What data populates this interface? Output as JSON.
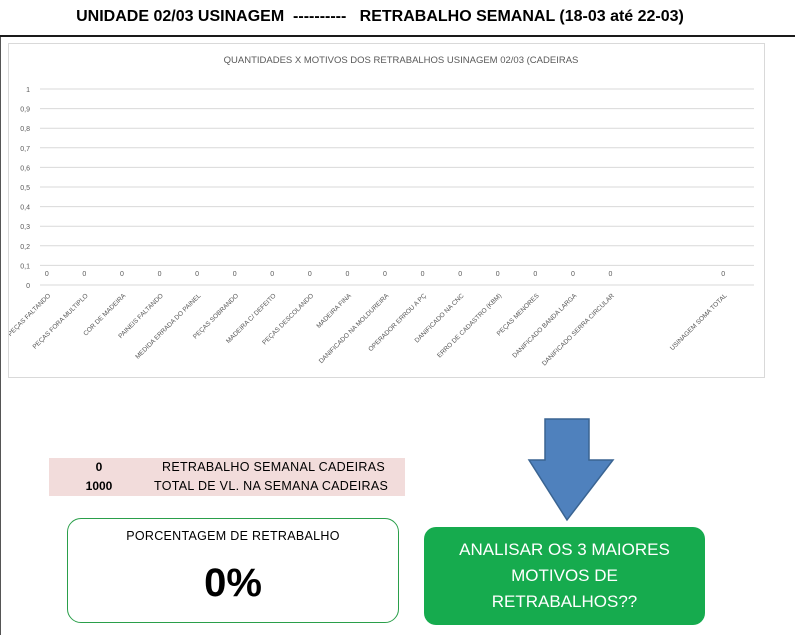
{
  "header": {
    "title": "UNIDADE 02/03 USINAGEM  ----------   RETRABALHO SEMANAL (18-03 até 22-03)"
  },
  "chart_data": {
    "type": "bar",
    "title": "QUANTIDADES X MOTIVOS DOS RETRABALHOS USINAGEM 02/03 (CADEIRAS",
    "xlabel": "",
    "ylabel": "",
    "ylim": [
      0,
      1
    ],
    "yticks": [
      "1",
      "0,9",
      "0,8",
      "0,7",
      "0,6",
      "0,5",
      "0,4",
      "0,3",
      "0,2",
      "0,1",
      "0"
    ],
    "grid": true,
    "categories": [
      "PEÇAS FALTANDO",
      "PEÇAS FORA MULTIPLO",
      "COR DE MADEIRA",
      "PAINEIS FALTANDO",
      "MEDIDA ERRADA DO PAINEL",
      "PEÇAS SOBRANDO",
      "MADEIRA C/ DEFEITO",
      "PEÇAS DESCOLANDO",
      "MADEIRA FINA",
      "DANIFICADO NA MOLDUREIRA",
      "OPERADOR ERROU A PÇ",
      "DANIFICADO NA CNC",
      "ERRO DE CADASTRO (KBM)",
      "PEÇAS MENORES",
      "DANIFICADO BANDA LARGA",
      "DANIFICADO SERRA CIRCULAR",
      "",
      "",
      "USINAGEM SOMA TOTAL"
    ],
    "values": [
      0,
      0,
      0,
      0,
      0,
      0,
      0,
      0,
      0,
      0,
      0,
      0,
      0,
      0,
      0,
      0,
      null,
      null,
      0
    ],
    "data_labels": [
      "0",
      "0",
      "0",
      "0",
      "0",
      "0",
      "0",
      "0",
      "0",
      "0",
      "0",
      "0",
      "0",
      "0",
      "0",
      "0",
      "",
      "",
      "0"
    ],
    "colors": {
      "grid": "#d9d9d9",
      "text": "#595959"
    }
  },
  "stats": {
    "rework_value": "0",
    "rework_label": "RETRABALHO SEMANAL CADEIRAS",
    "total_value": "1000",
    "total_label": "TOTAL DE VL. NA SEMANA CADEIRAS"
  },
  "percentage": {
    "label": "PORCENTAGEM DE RETRABALHO",
    "value": "0%"
  },
  "cta": {
    "text": "ANALISAR OS 3 MAIORES MOTIVOS DE RETRABALHOS??"
  },
  "colors": {
    "band": "#f2dcdb",
    "green_box": "#16ab4e",
    "green_border": "#2a9f4a",
    "arrow_fill": "#4f81bd",
    "arrow_stroke": "#3a6492"
  }
}
